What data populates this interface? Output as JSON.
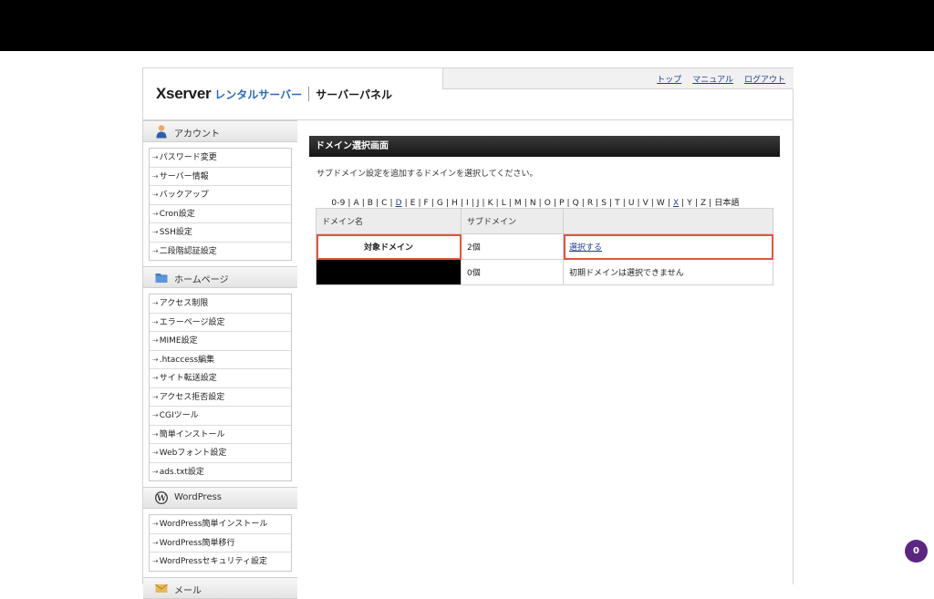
{
  "header": {
    "logo_brand": "Xserver",
    "logo_product": "レンタルサーバー",
    "logo_panel": "サーバーパネル",
    "links": [
      "トップ",
      "マニュアル",
      "ログアウト"
    ]
  },
  "sidebar": {
    "sections": [
      {
        "title": "アカウント",
        "icon": "person-icon",
        "items": [
          "パスワード変更",
          "サーバー情報",
          "バックアップ",
          "Cron設定",
          "SSH設定",
          "二段階認証設定"
        ]
      },
      {
        "title": "ホームページ",
        "icon": "folder-icon",
        "items": [
          "アクセス制限",
          "エラーページ設定",
          "MIME設定",
          ".htaccess編集",
          "サイト転送設定",
          "アクセス拒否設定",
          "CGIツール",
          "簡単インストール",
          "Webフォント設定",
          "ads.txt設定"
        ]
      },
      {
        "title": "WordPress",
        "icon": "wordpress-icon",
        "items": [
          "WordPress簡単インストール",
          "WordPress簡単移行",
          "WordPressセキュリティ設定"
        ]
      },
      {
        "title": "メール",
        "icon": "mail-icon",
        "items": []
      }
    ]
  },
  "main": {
    "title": "ドメイン選択画面",
    "description": "サブドメイン設定を追加するドメインを選択してください。",
    "alpha_index": [
      "0-9",
      "A",
      "B",
      "C",
      "D",
      "E",
      "F",
      "G",
      "H",
      "I",
      "J",
      "K",
      "L",
      "M",
      "N",
      "O",
      "P",
      "Q",
      "R",
      "S",
      "T",
      "U",
      "V",
      "W",
      "X",
      "Y",
      "Z",
      "日本語"
    ],
    "alpha_links": [
      "D",
      "X"
    ],
    "table": {
      "headers": [
        "ドメイン名",
        "サブドメイン",
        ""
      ],
      "rows": [
        {
          "domain": "対象ドメイン",
          "count": "2個",
          "action": "選択する"
        },
        {
          "domain": "",
          "count": "0個",
          "action": "初期ドメインは選択できません"
        }
      ]
    }
  },
  "badge": {
    "count": "0"
  },
  "colors": {
    "highlight": "#e0553e",
    "link": "#1f3f91",
    "brand_blue": "#2a6bb8",
    "badge": "#5b2580"
  }
}
